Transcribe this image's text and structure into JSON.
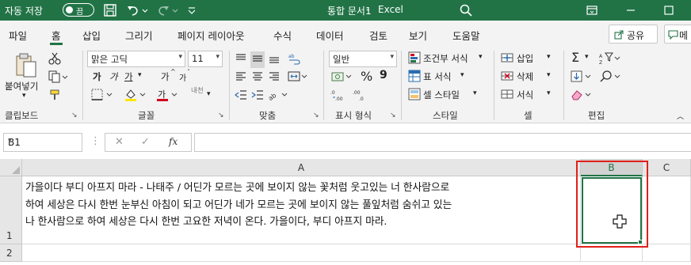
{
  "titlebar": {
    "autosave_label": "자동 저장",
    "toggle_state": "끔",
    "document_title": "통합 문서1",
    "separator": "-",
    "app_name": "Excel"
  },
  "menu": {
    "tabs": [
      "파일",
      "홈",
      "삽입",
      "그리기",
      "페이지 레이아웃",
      "수식",
      "데이터",
      "검토",
      "보기",
      "도움말"
    ],
    "active_tab": "홈",
    "share_label": "공유",
    "memo_label": "메"
  },
  "ribbon": {
    "clipboard": {
      "paste_label": "붙여넣기",
      "group_label": "클립보드"
    },
    "font": {
      "font_name": "맑은 고딕",
      "font_size": "11",
      "bold": "가",
      "italic": "가",
      "underline": "가",
      "grow": "가",
      "shrink": "가",
      "phonetic": "내천",
      "group_label": "글꼴"
    },
    "alignment": {
      "group_label": "맞춤"
    },
    "number": {
      "format": "일반",
      "currency": "₩",
      "percent": "%",
      "comma": "9",
      "group_label": "표시 형식"
    },
    "styles": {
      "conditional": "조건부 서식",
      "table": "표 서식",
      "cell_style": "셀 스타일",
      "group_label": "스타일"
    },
    "cells": {
      "insert": "삽입",
      "delete": "삭제",
      "format": "서식",
      "group_label": "셀"
    },
    "editing": {
      "group_label": "편집"
    }
  },
  "formula_bar": {
    "name_box": "B1",
    "cancel": "✕",
    "confirm": "✓",
    "fx": "fx",
    "formula": ""
  },
  "grid": {
    "columns": [
      "A",
      "B",
      "C"
    ],
    "selected_column": "B",
    "rows": [
      "1",
      "2"
    ],
    "cell_a1": "가을이다 부디 아프지 마라 - 나태주 / 어딘가 모르는 곳에 보이지 않는 꽃처럼 웃고있는 너 한사람으로\n 하여 세상은 다시 한번 눈부신 아침이 되고 어딘가 네가 모르는 곳에 보이지 않는 풀잎처럼 숨쉬고 있는\n 나 한사람으로 하여 세상은 다시 한번 고요한 저녁이 온다. 가을이다, 부디 아프지 마라.",
    "active_cell": "B1"
  },
  "colors": {
    "excel_green": "#217346",
    "highlight_red": "#e0201a",
    "font_color_red": "#d0021b",
    "fill_yellow": "#ffe600"
  }
}
